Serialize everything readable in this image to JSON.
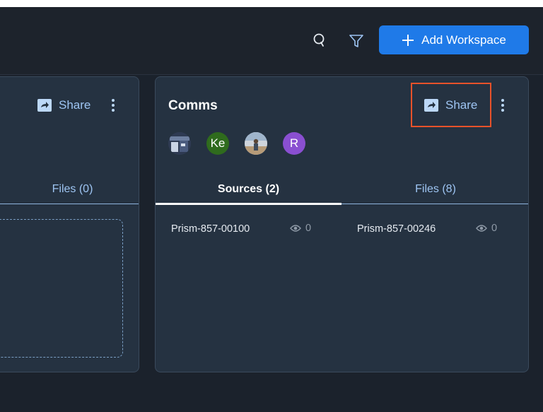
{
  "toolbar": {
    "search_icon": "search-icon",
    "filter_icon": "filter-icon",
    "add_label": "Add Workspace",
    "accent": "#1f7ae8"
  },
  "workspaces": [
    {
      "name": "",
      "share_label": "Share",
      "tabs": [
        {
          "label": "Files (0)"
        }
      ]
    },
    {
      "name": "Comms",
      "share_label": "Share",
      "avatars": [
        {
          "kind": "photo",
          "initials": ""
        },
        {
          "kind": "initials",
          "initials": "Ke",
          "color": "#2f6b1d"
        },
        {
          "kind": "photo",
          "initials": ""
        },
        {
          "kind": "initials",
          "initials": "R",
          "color": "#8a4fd1"
        }
      ],
      "tabs": [
        {
          "label": "Sources (2)",
          "active": true
        },
        {
          "label": "Files (8)",
          "active": false
        }
      ],
      "sources": [
        {
          "name": "Prism-857-00100",
          "views": "0"
        },
        {
          "name": "Prism-857-00246",
          "views": "0"
        }
      ]
    }
  ],
  "highlight_color": "#e8522a"
}
